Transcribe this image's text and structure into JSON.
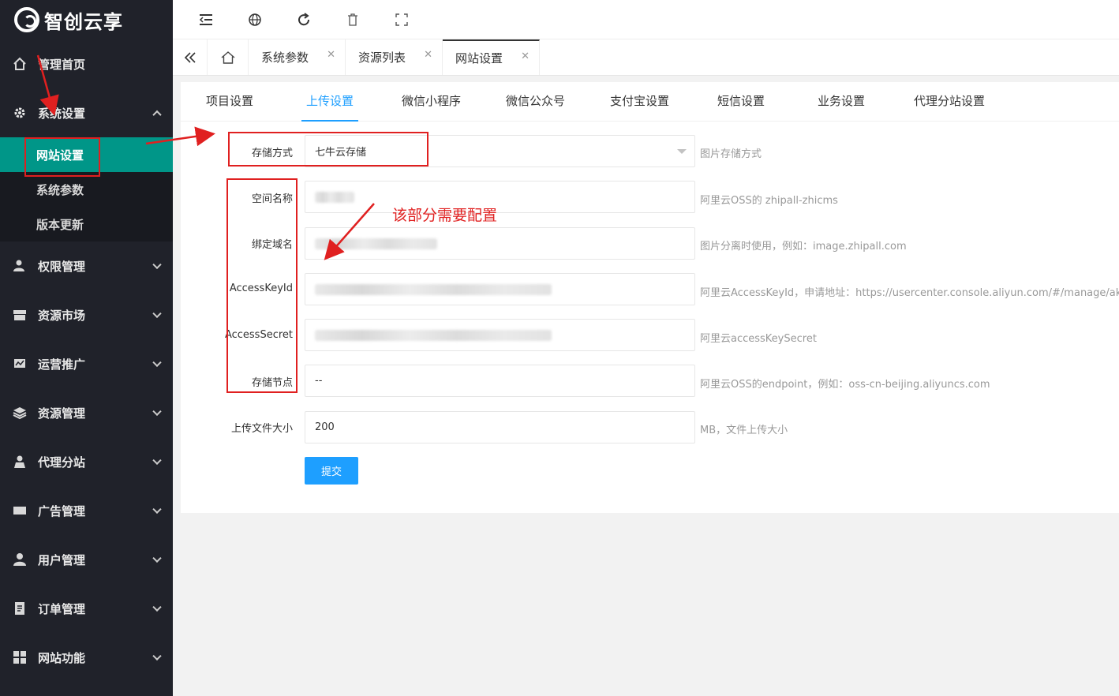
{
  "app": {
    "logo_text": "智创云享"
  },
  "sidebar": {
    "items": [
      {
        "label": "管理首页",
        "icon": "home-icon"
      },
      {
        "label": "系统设置",
        "icon": "gear-icon",
        "expanded": true,
        "children": [
          {
            "label": "网站设置",
            "active": true
          },
          {
            "label": "系统参数"
          },
          {
            "label": "版本更新"
          }
        ]
      },
      {
        "label": "权限管理",
        "icon": "permission-icon"
      },
      {
        "label": "资源市场",
        "icon": "market-icon"
      },
      {
        "label": "运营推广",
        "icon": "promotion-icon"
      },
      {
        "label": "资源管理",
        "icon": "layers-icon"
      },
      {
        "label": "代理分站",
        "icon": "agent-icon"
      },
      {
        "label": "广告管理",
        "icon": "ad-icon"
      },
      {
        "label": "用户管理",
        "icon": "user-icon"
      },
      {
        "label": "订单管理",
        "icon": "order-icon"
      },
      {
        "label": "网站功能",
        "icon": "apps-icon"
      }
    ]
  },
  "topbar": {
    "icons": [
      "menu-collapse-icon",
      "globe-icon",
      "refresh-icon",
      "trash-icon",
      "fullscreen-icon"
    ]
  },
  "page_tabs": [
    {
      "label": "系统参数"
    },
    {
      "label": "资源列表"
    },
    {
      "label": "网站设置",
      "active": true
    }
  ],
  "settings_tabs": [
    "项目设置",
    "上传设置",
    "微信小程序",
    "微信公众号",
    "支付宝设置",
    "短信设置",
    "业务设置",
    "代理分站设置"
  ],
  "active_settings_tab": "上传设置",
  "form": {
    "storage": {
      "label": "存储方式",
      "value": "七牛云存储",
      "hint": "图片存储方式"
    },
    "bucket": {
      "label": "空间名称",
      "hint": "阿里云OSS的 zhipall-zhicms"
    },
    "domain": {
      "label": "绑定域名",
      "hint": "图片分离时使用，例如：image.zhipall.com"
    },
    "access_key_id": {
      "label": "AccessKeyId",
      "hint": "阿里云AccessKeyId，申请地址：https://usercenter.console.aliyun.com/#/manage/ak"
    },
    "access_secret": {
      "label": "AccessSecret",
      "hint": "阿里云accessKeySecret"
    },
    "endpoint": {
      "label": "存储节点",
      "value": "--",
      "hint": "阿里云OSS的endpoint，例如：oss-cn-beijing.aliyuncs.com"
    },
    "max_size": {
      "label": "上传文件大小",
      "value": "200",
      "hint": "MB，文件上传大小"
    },
    "submit_label": "提交"
  },
  "annotation": {
    "note": "该部分需要配置",
    "color": "#e02020"
  },
  "colors": {
    "sidebar_bg": "#20222a",
    "active_menu": "#009688",
    "accent": "#1e9fff"
  }
}
